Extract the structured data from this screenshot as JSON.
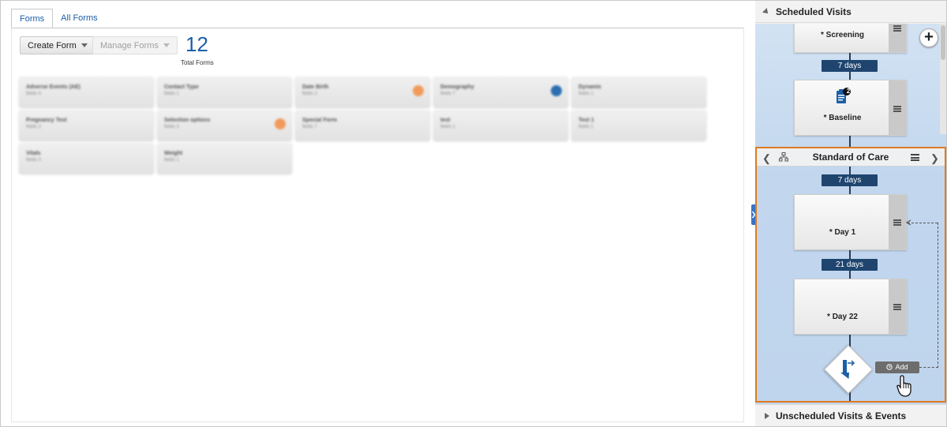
{
  "tabs": [
    {
      "label": "Forms",
      "active": true
    },
    {
      "label": "All Forms",
      "active": false
    }
  ],
  "toolbar": {
    "create_form_label": "Create Form",
    "manage_forms_label": "Manage Forms"
  },
  "summary": {
    "count": "12",
    "label": "Total Forms"
  },
  "form_cards": [
    {
      "title": "Adverse Events (AE)",
      "subtitle": "fields 4",
      "badge_color": ""
    },
    {
      "title": "Contact Type",
      "subtitle": "fields 1",
      "badge_color": ""
    },
    {
      "title": "Date Birth",
      "subtitle": "fields 2",
      "badge_color": "#f29a5b"
    },
    {
      "title": "Demography",
      "subtitle": "fields 7",
      "badge_color": "#2b6fb0"
    },
    {
      "title": "Dynamic",
      "subtitle": "fields 1",
      "badge_color": ""
    },
    {
      "title": "Pregnancy Test",
      "subtitle": "fields 2",
      "badge_color": ""
    },
    {
      "title": "Selection options",
      "subtitle": "fields 3",
      "badge_color": "#f29a5b"
    },
    {
      "title": "Special Form",
      "subtitle": "fields 7",
      "badge_color": ""
    },
    {
      "title": "test",
      "subtitle": "fields 1",
      "badge_color": ""
    },
    {
      "title": "Test 1",
      "subtitle": "fields 1",
      "badge_color": ""
    },
    {
      "title": "Vitals",
      "subtitle": "fields 3",
      "badge_color": ""
    },
    {
      "title": "Weight",
      "subtitle": "fields 1",
      "badge_color": ""
    }
  ],
  "right_panel": {
    "scheduled_title": "Scheduled Visits",
    "unscheduled_title": "Unscheduled Visits & Events",
    "visits": [
      {
        "name": "* Screening"
      },
      {
        "name": "* Baseline",
        "form_count": "2"
      }
    ],
    "intervals": [
      "7 days",
      "7 days",
      "21 days"
    ],
    "branch": {
      "title": "Standard of Care",
      "visits": [
        {
          "name": "* Day 1"
        },
        {
          "name": "* Day 22"
        }
      ],
      "add_label": "Add"
    }
  },
  "colors": {
    "accent": "#1b5fa8",
    "interval_pill": "#1f456f",
    "branch_border": "#e07a21",
    "timeline_bg": "#c7daef"
  }
}
